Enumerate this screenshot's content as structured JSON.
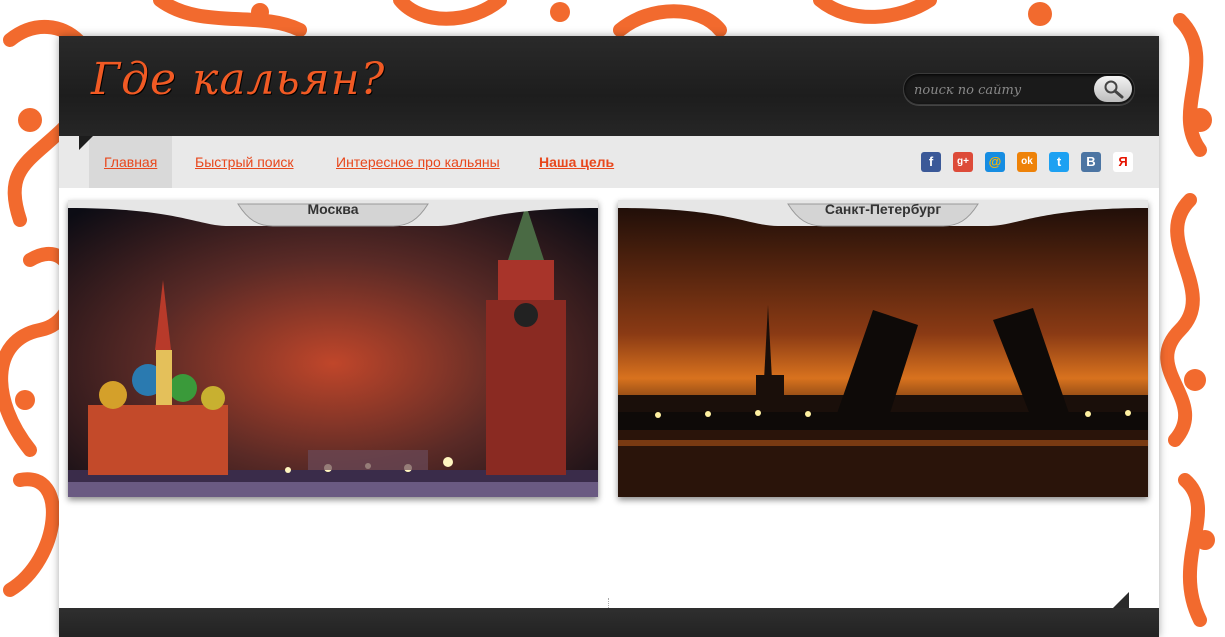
{
  "header": {
    "logo_text": "Где кальян?"
  },
  "search": {
    "placeholder": "поиск по сайту",
    "icon": "magnifier-icon"
  },
  "nav": {
    "items": [
      {
        "label": "Главная"
      },
      {
        "label": "Быстрый поиск"
      },
      {
        "label": "Интересное про кальяны"
      },
      {
        "label": "Наша цель"
      }
    ]
  },
  "social": [
    {
      "name": "facebook",
      "glyph": "f",
      "color": "#3b5998"
    },
    {
      "name": "google-plus",
      "glyph": "g+",
      "color": "#dd4b39"
    },
    {
      "name": "mail-ru",
      "glyph": "@",
      "color": "#168de2"
    },
    {
      "name": "odnoklassniki",
      "glyph": "ok",
      "color": "#ee8208"
    },
    {
      "name": "twitter",
      "glyph": "t",
      "color": "#1da1f2"
    },
    {
      "name": "vkontakte",
      "glyph": "B",
      "color": "#4c75a3"
    },
    {
      "name": "yandex",
      "glyph": "Я",
      "color": "#e61400"
    }
  ],
  "cities": [
    {
      "title": "Москва"
    },
    {
      "title": "Санкт-Петербург"
    }
  ],
  "colors": {
    "accent": "#f15a24",
    "link": "#e8471c",
    "header_bg": "#1d1d1d",
    "nav_bg": "#e9e9e9"
  }
}
